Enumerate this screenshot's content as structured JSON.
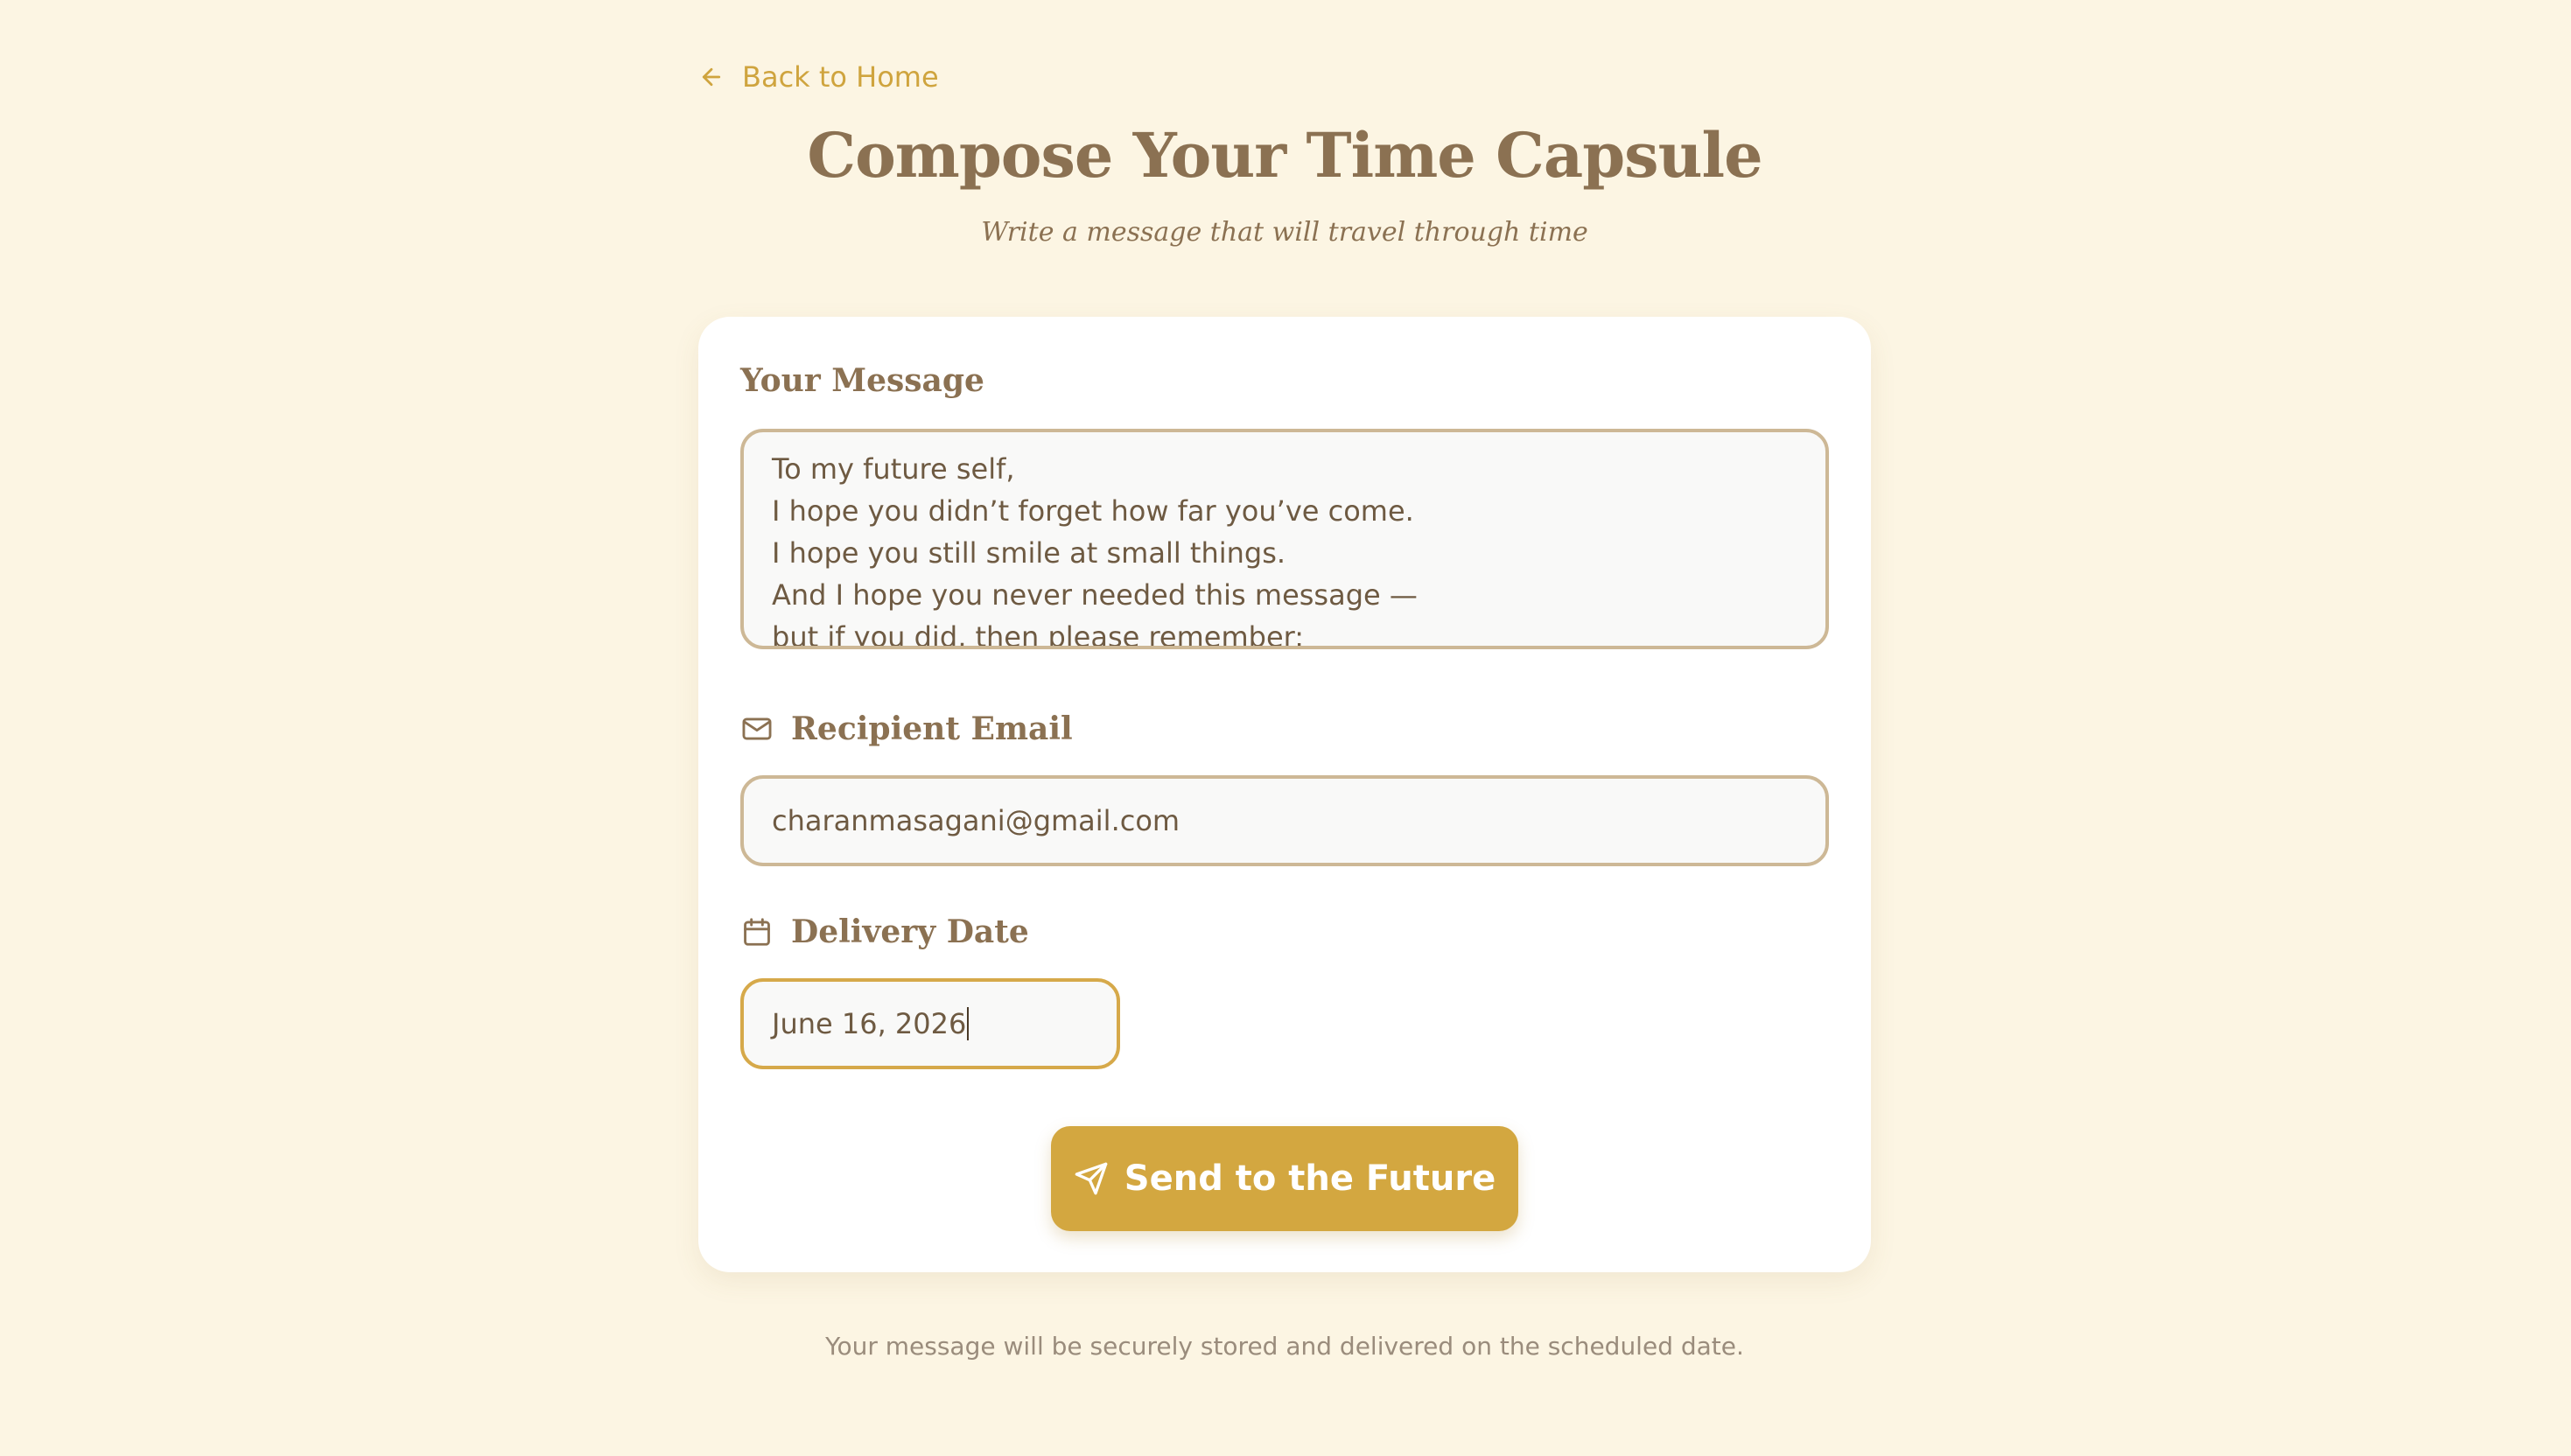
{
  "nav": {
    "back_label": "Back to Home",
    "back_icon": "arrow-left-icon"
  },
  "header": {
    "title": "Compose Your Time Capsule",
    "subtitle": "Write a message that will travel through time"
  },
  "form": {
    "message": {
      "label": "Your Message",
      "lines": [
        "To my future self,",
        "I hope you didn’t forget how far you’ve come.",
        "I hope you still smile at small things.",
        "And I hope you never needed this message —",
        "but if you did, then please remember:"
      ]
    },
    "email": {
      "label": "Recipient Email",
      "icon": "mail-icon",
      "value": "charanmasagani@gmail.com"
    },
    "date": {
      "label": "Delivery Date",
      "icon": "calendar-icon",
      "value": "June 16, 2026"
    },
    "submit": {
      "label": "Send to the Future",
      "icon": "send-icon"
    }
  },
  "footer": {
    "note": "Your message will be securely stored and delivered on the scheduled date."
  },
  "colors": {
    "background": "#fcf5e3",
    "accent": "#d3a740",
    "heading": "#8b7152",
    "text": "#6e5a42",
    "muted": "#9a8c7c"
  }
}
